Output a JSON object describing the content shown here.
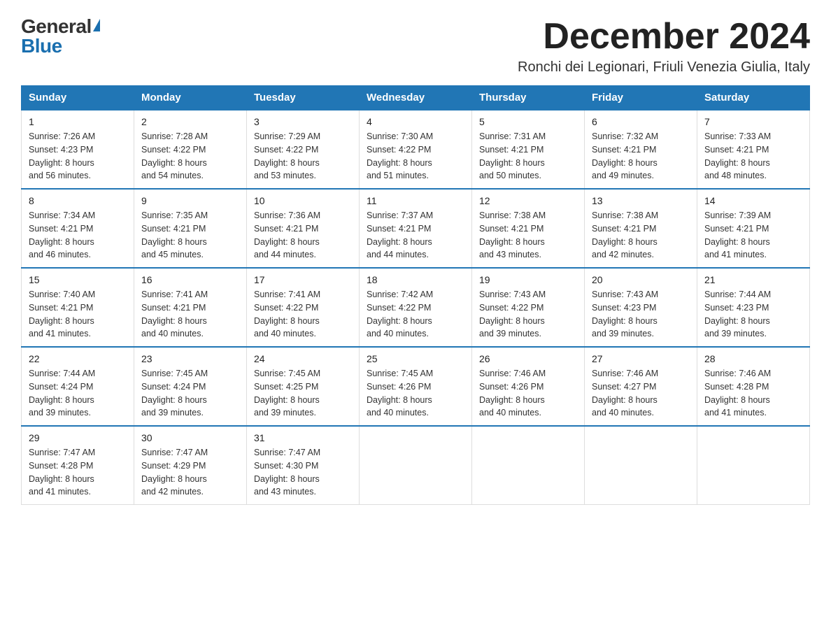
{
  "logo": {
    "general": "General",
    "blue": "Blue"
  },
  "title": "December 2024",
  "location": "Ronchi dei Legionari, Friuli Venezia Giulia, Italy",
  "days_of_week": [
    "Sunday",
    "Monday",
    "Tuesday",
    "Wednesday",
    "Thursday",
    "Friday",
    "Saturday"
  ],
  "weeks": [
    [
      {
        "day": "1",
        "sunrise": "7:26 AM",
        "sunset": "4:23 PM",
        "daylight": "8 hours and 56 minutes."
      },
      {
        "day": "2",
        "sunrise": "7:28 AM",
        "sunset": "4:22 PM",
        "daylight": "8 hours and 54 minutes."
      },
      {
        "day": "3",
        "sunrise": "7:29 AM",
        "sunset": "4:22 PM",
        "daylight": "8 hours and 53 minutes."
      },
      {
        "day": "4",
        "sunrise": "7:30 AM",
        "sunset": "4:22 PM",
        "daylight": "8 hours and 51 minutes."
      },
      {
        "day": "5",
        "sunrise": "7:31 AM",
        "sunset": "4:21 PM",
        "daylight": "8 hours and 50 minutes."
      },
      {
        "day": "6",
        "sunrise": "7:32 AM",
        "sunset": "4:21 PM",
        "daylight": "8 hours and 49 minutes."
      },
      {
        "day": "7",
        "sunrise": "7:33 AM",
        "sunset": "4:21 PM",
        "daylight": "8 hours and 48 minutes."
      }
    ],
    [
      {
        "day": "8",
        "sunrise": "7:34 AM",
        "sunset": "4:21 PM",
        "daylight": "8 hours and 46 minutes."
      },
      {
        "day": "9",
        "sunrise": "7:35 AM",
        "sunset": "4:21 PM",
        "daylight": "8 hours and 45 minutes."
      },
      {
        "day": "10",
        "sunrise": "7:36 AM",
        "sunset": "4:21 PM",
        "daylight": "8 hours and 44 minutes."
      },
      {
        "day": "11",
        "sunrise": "7:37 AM",
        "sunset": "4:21 PM",
        "daylight": "8 hours and 44 minutes."
      },
      {
        "day": "12",
        "sunrise": "7:38 AM",
        "sunset": "4:21 PM",
        "daylight": "8 hours and 43 minutes."
      },
      {
        "day": "13",
        "sunrise": "7:38 AM",
        "sunset": "4:21 PM",
        "daylight": "8 hours and 42 minutes."
      },
      {
        "day": "14",
        "sunrise": "7:39 AM",
        "sunset": "4:21 PM",
        "daylight": "8 hours and 41 minutes."
      }
    ],
    [
      {
        "day": "15",
        "sunrise": "7:40 AM",
        "sunset": "4:21 PM",
        "daylight": "8 hours and 41 minutes."
      },
      {
        "day": "16",
        "sunrise": "7:41 AM",
        "sunset": "4:21 PM",
        "daylight": "8 hours and 40 minutes."
      },
      {
        "day": "17",
        "sunrise": "7:41 AM",
        "sunset": "4:22 PM",
        "daylight": "8 hours and 40 minutes."
      },
      {
        "day": "18",
        "sunrise": "7:42 AM",
        "sunset": "4:22 PM",
        "daylight": "8 hours and 40 minutes."
      },
      {
        "day": "19",
        "sunrise": "7:43 AM",
        "sunset": "4:22 PM",
        "daylight": "8 hours and 39 minutes."
      },
      {
        "day": "20",
        "sunrise": "7:43 AM",
        "sunset": "4:23 PM",
        "daylight": "8 hours and 39 minutes."
      },
      {
        "day": "21",
        "sunrise": "7:44 AM",
        "sunset": "4:23 PM",
        "daylight": "8 hours and 39 minutes."
      }
    ],
    [
      {
        "day": "22",
        "sunrise": "7:44 AM",
        "sunset": "4:24 PM",
        "daylight": "8 hours and 39 minutes."
      },
      {
        "day": "23",
        "sunrise": "7:45 AM",
        "sunset": "4:24 PM",
        "daylight": "8 hours and 39 minutes."
      },
      {
        "day": "24",
        "sunrise": "7:45 AM",
        "sunset": "4:25 PM",
        "daylight": "8 hours and 39 minutes."
      },
      {
        "day": "25",
        "sunrise": "7:45 AM",
        "sunset": "4:26 PM",
        "daylight": "8 hours and 40 minutes."
      },
      {
        "day": "26",
        "sunrise": "7:46 AM",
        "sunset": "4:26 PM",
        "daylight": "8 hours and 40 minutes."
      },
      {
        "day": "27",
        "sunrise": "7:46 AM",
        "sunset": "4:27 PM",
        "daylight": "8 hours and 40 minutes."
      },
      {
        "day": "28",
        "sunrise": "7:46 AM",
        "sunset": "4:28 PM",
        "daylight": "8 hours and 41 minutes."
      }
    ],
    [
      {
        "day": "29",
        "sunrise": "7:47 AM",
        "sunset": "4:28 PM",
        "daylight": "8 hours and 41 minutes."
      },
      {
        "day": "30",
        "sunrise": "7:47 AM",
        "sunset": "4:29 PM",
        "daylight": "8 hours and 42 minutes."
      },
      {
        "day": "31",
        "sunrise": "7:47 AM",
        "sunset": "4:30 PM",
        "daylight": "8 hours and 43 minutes."
      },
      null,
      null,
      null,
      null
    ]
  ],
  "labels": {
    "sunrise": "Sunrise:",
    "sunset": "Sunset:",
    "daylight": "Daylight:"
  }
}
